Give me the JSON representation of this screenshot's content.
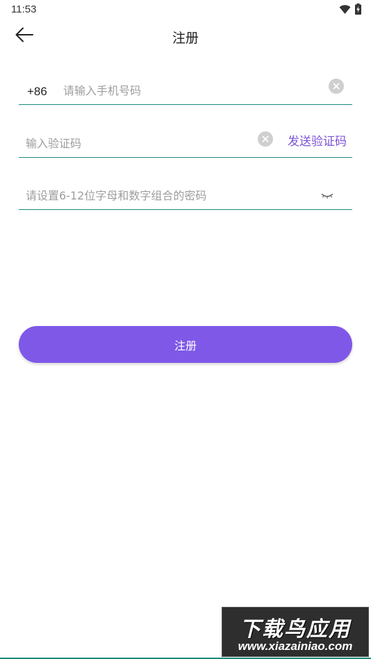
{
  "status_bar": {
    "time": "11:53",
    "icons": [
      "wifi-icon",
      "battery-icon"
    ]
  },
  "toolbar": {
    "back_icon": "arrow-left-icon",
    "title": "注册"
  },
  "phone_field": {
    "country_code": "+86",
    "placeholder": "请输入手机号码",
    "value": ""
  },
  "code_field": {
    "placeholder": "输入验证码",
    "value": "",
    "send_label": "发送验证码"
  },
  "password_field": {
    "placeholder": "请设置6-12位字母和数字组合的密码",
    "value": "",
    "visibility_icon": "eye-closed-icon"
  },
  "register_button": {
    "label": "注册"
  },
  "watermark": {
    "title": "下载鸟应用",
    "url": "www.xiazainiao.com"
  },
  "colors": {
    "accent": "#7f58e8",
    "link": "#7b52d6",
    "underline": "#1a8a7c",
    "placeholder": "#9e9e9e"
  }
}
